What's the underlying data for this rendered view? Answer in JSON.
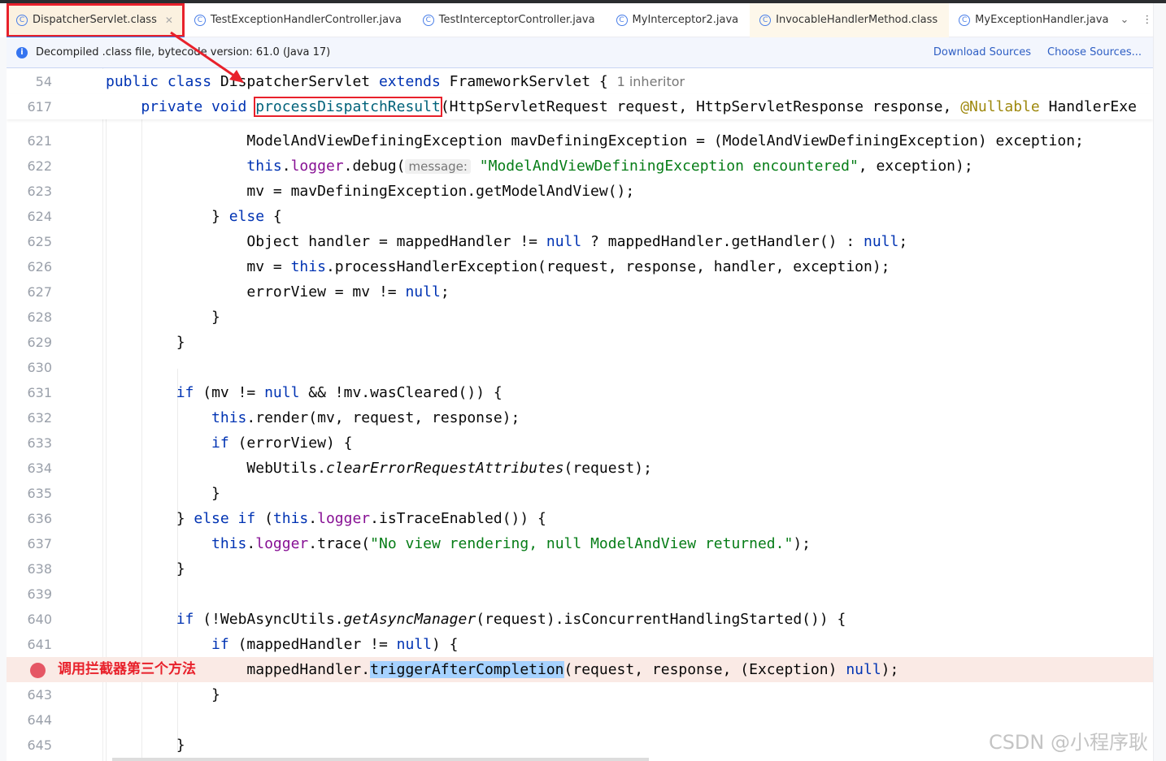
{
  "tabs": [
    {
      "label": "DispatcherServlet.class",
      "active": true,
      "closable": true
    },
    {
      "label": "TestExceptionHandlerController.java"
    },
    {
      "label": "TestInterceptorController.java"
    },
    {
      "label": "MyInterceptor2.java"
    },
    {
      "label": "InvocableHandlerMethod.class",
      "tinted": true
    },
    {
      "label": "MyExceptionHandler.java"
    }
  ],
  "tab_icon": "C",
  "info_bar": {
    "icon": "info-icon",
    "text": "Decompiled .class file, bytecode version: 61.0 (Java 17)",
    "download": "Download Sources",
    "choose": "Choose Sources..."
  },
  "annotation": {
    "text": "调用拦截器第三个方法",
    "color": "#e8212b"
  },
  "watermark": "CSDN @小程序耿",
  "sticky": [
    {
      "n": "54",
      "t": [
        [
          "public class ",
          "kw"
        ],
        [
          "DispatcherServlet ",
          ""
        ],
        [
          "extends ",
          "kw"
        ],
        [
          "FrameworkServlet { ",
          ""
        ],
        [
          "1 inheritor",
          "inlay"
        ]
      ]
    },
    {
      "n": "617",
      "t": [
        [
          "    private void ",
          "kw"
        ],
        [
          "processDispatchResult",
          "mth box"
        ],
        [
          "(HttpServletRequest request, HttpServletResponse response, ",
          ""
        ],
        [
          "@Nullable ",
          "ann"
        ],
        [
          "HandlerExe",
          ""
        ]
      ]
    }
  ],
  "lines": [
    {
      "n": "621",
      "t": [
        [
          "                ModelAndViewDefiningException mavDefiningException = (ModelAndViewDefiningException) exception;",
          ""
        ]
      ]
    },
    {
      "n": "622",
      "t": [
        [
          "                ",
          ""
        ],
        [
          "this",
          "kw"
        ],
        [
          ".",
          ""
        ],
        [
          "logger",
          "fld"
        ],
        [
          ".debug(",
          ""
        ],
        [
          "message:",
          "hint"
        ],
        [
          " ",
          ""
        ],
        [
          "\"ModelAndViewDefiningException encountered\"",
          "str"
        ],
        [
          ", exception);",
          ""
        ]
      ]
    },
    {
      "n": "623",
      "t": [
        [
          "                mv = mavDefiningException.getModelAndView();",
          ""
        ]
      ]
    },
    {
      "n": "624",
      "t": [
        [
          "            } ",
          ""
        ],
        [
          "else",
          "kw"
        ],
        [
          " {",
          ""
        ]
      ]
    },
    {
      "n": "625",
      "t": [
        [
          "                Object handler = mappedHandler != ",
          ""
        ],
        [
          "null",
          "kw"
        ],
        [
          " ? mappedHandler.getHandler() : ",
          ""
        ],
        [
          "null",
          "kw"
        ],
        [
          ";",
          ""
        ]
      ]
    },
    {
      "n": "626",
      "t": [
        [
          "                mv = ",
          ""
        ],
        [
          "this",
          "kw"
        ],
        [
          ".processHandlerException(request, response, handler, exception);",
          ""
        ]
      ]
    },
    {
      "n": "627",
      "t": [
        [
          "                errorView = mv != ",
          ""
        ],
        [
          "null",
          "kw"
        ],
        [
          ";",
          ""
        ]
      ]
    },
    {
      "n": "628",
      "t": [
        [
          "            }",
          ""
        ]
      ]
    },
    {
      "n": "629",
      "t": [
        [
          "        }",
          ""
        ]
      ]
    },
    {
      "n": "630",
      "t": []
    },
    {
      "n": "631",
      "t": [
        [
          "        ",
          ""
        ],
        [
          "if",
          "kw"
        ],
        [
          " (mv != ",
          ""
        ],
        [
          "null",
          "kw"
        ],
        [
          " && !mv.wasCleared()) {",
          ""
        ]
      ]
    },
    {
      "n": "632",
      "t": [
        [
          "            ",
          ""
        ],
        [
          "this",
          "kw"
        ],
        [
          ".render(mv, request, response);",
          ""
        ]
      ]
    },
    {
      "n": "633",
      "t": [
        [
          "            ",
          ""
        ],
        [
          "if",
          "kw"
        ],
        [
          " (errorView) {",
          ""
        ]
      ]
    },
    {
      "n": "634",
      "t": [
        [
          "                WebUtils.",
          ""
        ],
        [
          "clearErrorRequestAttributes",
          "it"
        ],
        [
          "(request);",
          ""
        ]
      ]
    },
    {
      "n": "635",
      "t": [
        [
          "            }",
          ""
        ]
      ]
    },
    {
      "n": "636",
      "t": [
        [
          "        } ",
          ""
        ],
        [
          "else if",
          "kw"
        ],
        [
          " (",
          ""
        ],
        [
          "this",
          "kw"
        ],
        [
          ".",
          ""
        ],
        [
          "logger",
          "fld"
        ],
        [
          ".isTraceEnabled()) {",
          ""
        ]
      ]
    },
    {
      "n": "637",
      "t": [
        [
          "            ",
          ""
        ],
        [
          "this",
          "kw"
        ],
        [
          ".",
          ""
        ],
        [
          "logger",
          "fld"
        ],
        [
          ".trace(",
          ""
        ],
        [
          "\"No view rendering, null ModelAndView returned.\"",
          "str"
        ],
        [
          ");",
          ""
        ]
      ]
    },
    {
      "n": "638",
      "t": [
        [
          "        }",
          ""
        ]
      ]
    },
    {
      "n": "639",
      "t": []
    },
    {
      "n": "640",
      "t": [
        [
          "        ",
          ""
        ],
        [
          "if",
          "kw"
        ],
        [
          " (!WebAsyncUtils.",
          ""
        ],
        [
          "getAsyncManager",
          "it"
        ],
        [
          "(request).isConcurrentHandlingStarted()) {",
          ""
        ]
      ]
    },
    {
      "n": "641",
      "t": [
        [
          "            ",
          ""
        ],
        [
          "if",
          "kw"
        ],
        [
          " (mappedHandler != ",
          ""
        ],
        [
          "null",
          "kw"
        ],
        [
          ") {",
          ""
        ]
      ]
    },
    {
      "n": "",
      "breakpoint": true,
      "t": [
        [
          "                mappedHandler.",
          ""
        ],
        [
          "triggerAfterCompletion",
          "sel"
        ],
        [
          "(request, response, (Exception) ",
          ""
        ],
        [
          "null",
          "kw"
        ],
        [
          ");",
          ""
        ]
      ]
    },
    {
      "n": "643",
      "t": [
        [
          "            }",
          ""
        ]
      ]
    },
    {
      "n": "644",
      "t": []
    },
    {
      "n": "645",
      "t": [
        [
          "        }",
          ""
        ]
      ]
    }
  ]
}
